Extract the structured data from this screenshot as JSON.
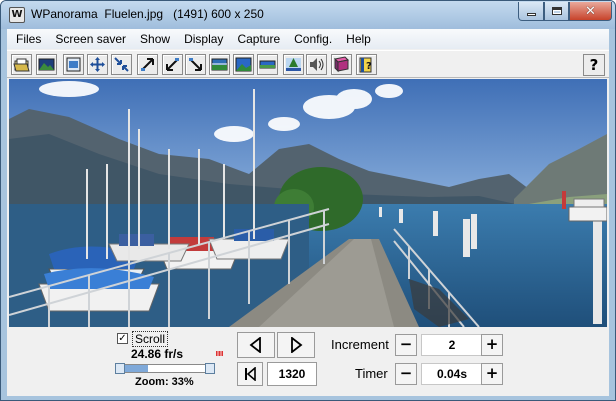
{
  "window": {
    "app_icon": "W",
    "title": "WPanorama  Fluelen.jpg   (1491) 600 x 250",
    "close_glyph": "✕"
  },
  "menu": [
    "Files",
    "Screen saver",
    "Show",
    "Display",
    "Capture",
    "Config.",
    "Help"
  ],
  "toolbar": {
    "icons": [
      "open-folder-icon",
      "landscape-image-icon",
      "fit-window-icon",
      "move-arrows-icon",
      "shrink-arrows-icon",
      "arrow-up-right-icon",
      "arrow-down-left-icon",
      "arrow-down-right-icon",
      "panorama-strip-icon",
      "panorama-blue-icon",
      "panorama-flat-icon",
      "landscape-tree-icon",
      "speaker-icon",
      "book-icon",
      "help-book-icon"
    ],
    "help_label": "?"
  },
  "controls": {
    "scroll_checked": true,
    "scroll_check_mark": "✓",
    "scroll_label": "Scroll",
    "fps": "24.86 fr/s",
    "zoom": "Zoom: 33%",
    "zoom_fraction": 0.33,
    "position": "1320",
    "increment_label": "Increment",
    "increment_value": "2",
    "timer_label": "Timer",
    "timer_value": "0.04s",
    "minus": "−",
    "plus": "+"
  },
  "colors": {
    "sky_top": "#3f6fb6",
    "sky_bottom": "#cfe0f2",
    "water": "#2c5f8e",
    "accent_fill": "#7fa9d9"
  }
}
